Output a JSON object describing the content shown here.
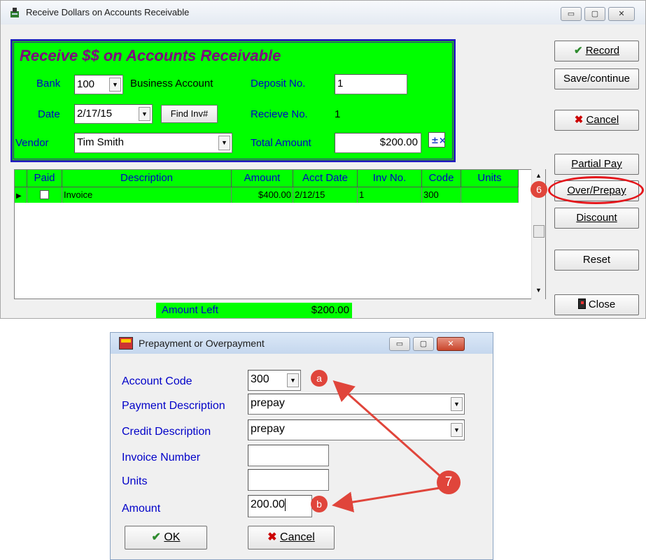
{
  "main_window": {
    "title": "Receive Dollars on Accounts Receivable",
    "caption_buttons": {
      "minimize": "▭",
      "maximize": "▢",
      "close": "✕"
    }
  },
  "form": {
    "heading": "Receive $$ on Accounts Receivable",
    "bank_label": "Bank",
    "bank_value": "100",
    "bank_name": "Business Account",
    "deposit_label": "Deposit No.",
    "deposit_value": "1",
    "date_label": "Date",
    "date_value": "2/17/15",
    "find_inv_label": "Find Inv#",
    "receive_label": "Recieve No.",
    "receive_value": "1",
    "vendor_label": "Vendor",
    "vendor_value": "Tim Smith",
    "total_label": "Total Amount",
    "total_value": "$200.00"
  },
  "side_buttons": {
    "record": "Record",
    "save_continue": "Save/continue",
    "cancel": "Cancel",
    "partial_pay": "Partial Pay",
    "over_prepay": "Over/Prepay",
    "discount": "Discount",
    "reset": "Reset",
    "close": "Close"
  },
  "grid": {
    "columns": [
      "Paid",
      "Description",
      "Amount",
      "Acct Date",
      "Inv No.",
      "Code",
      "Units"
    ],
    "rows": [
      {
        "paid": false,
        "description": "Invoice",
        "amount": "$400.00",
        "acct_date": "2/12/15",
        "inv_no": "1",
        "code": "300",
        "units": ""
      }
    ]
  },
  "amount_left": {
    "label": "Amount Left",
    "value": "$200.00"
  },
  "dialog": {
    "title": "Prepayment or Overpayment",
    "account_code_label": "Account Code",
    "account_code_value": "300",
    "payment_desc_label": "Payment Description",
    "payment_desc_value": "prepay",
    "credit_desc_label": "Credit Description",
    "credit_desc_value": "prepay",
    "invoice_number_label": "Invoice Number",
    "invoice_number_value": "",
    "units_label": "Units",
    "units_value": "",
    "amount_label": "Amount",
    "amount_value": "200.00",
    "ok_label": "OK",
    "cancel_label": "Cancel"
  },
  "annotations": {
    "step6": "6",
    "step7": "7",
    "a": "a",
    "b": "b"
  },
  "colors": {
    "panel_green": "#00ff00",
    "heading_purple": "#800080",
    "label_blue": "#0000c8",
    "annotation_red": "#e0453b"
  }
}
